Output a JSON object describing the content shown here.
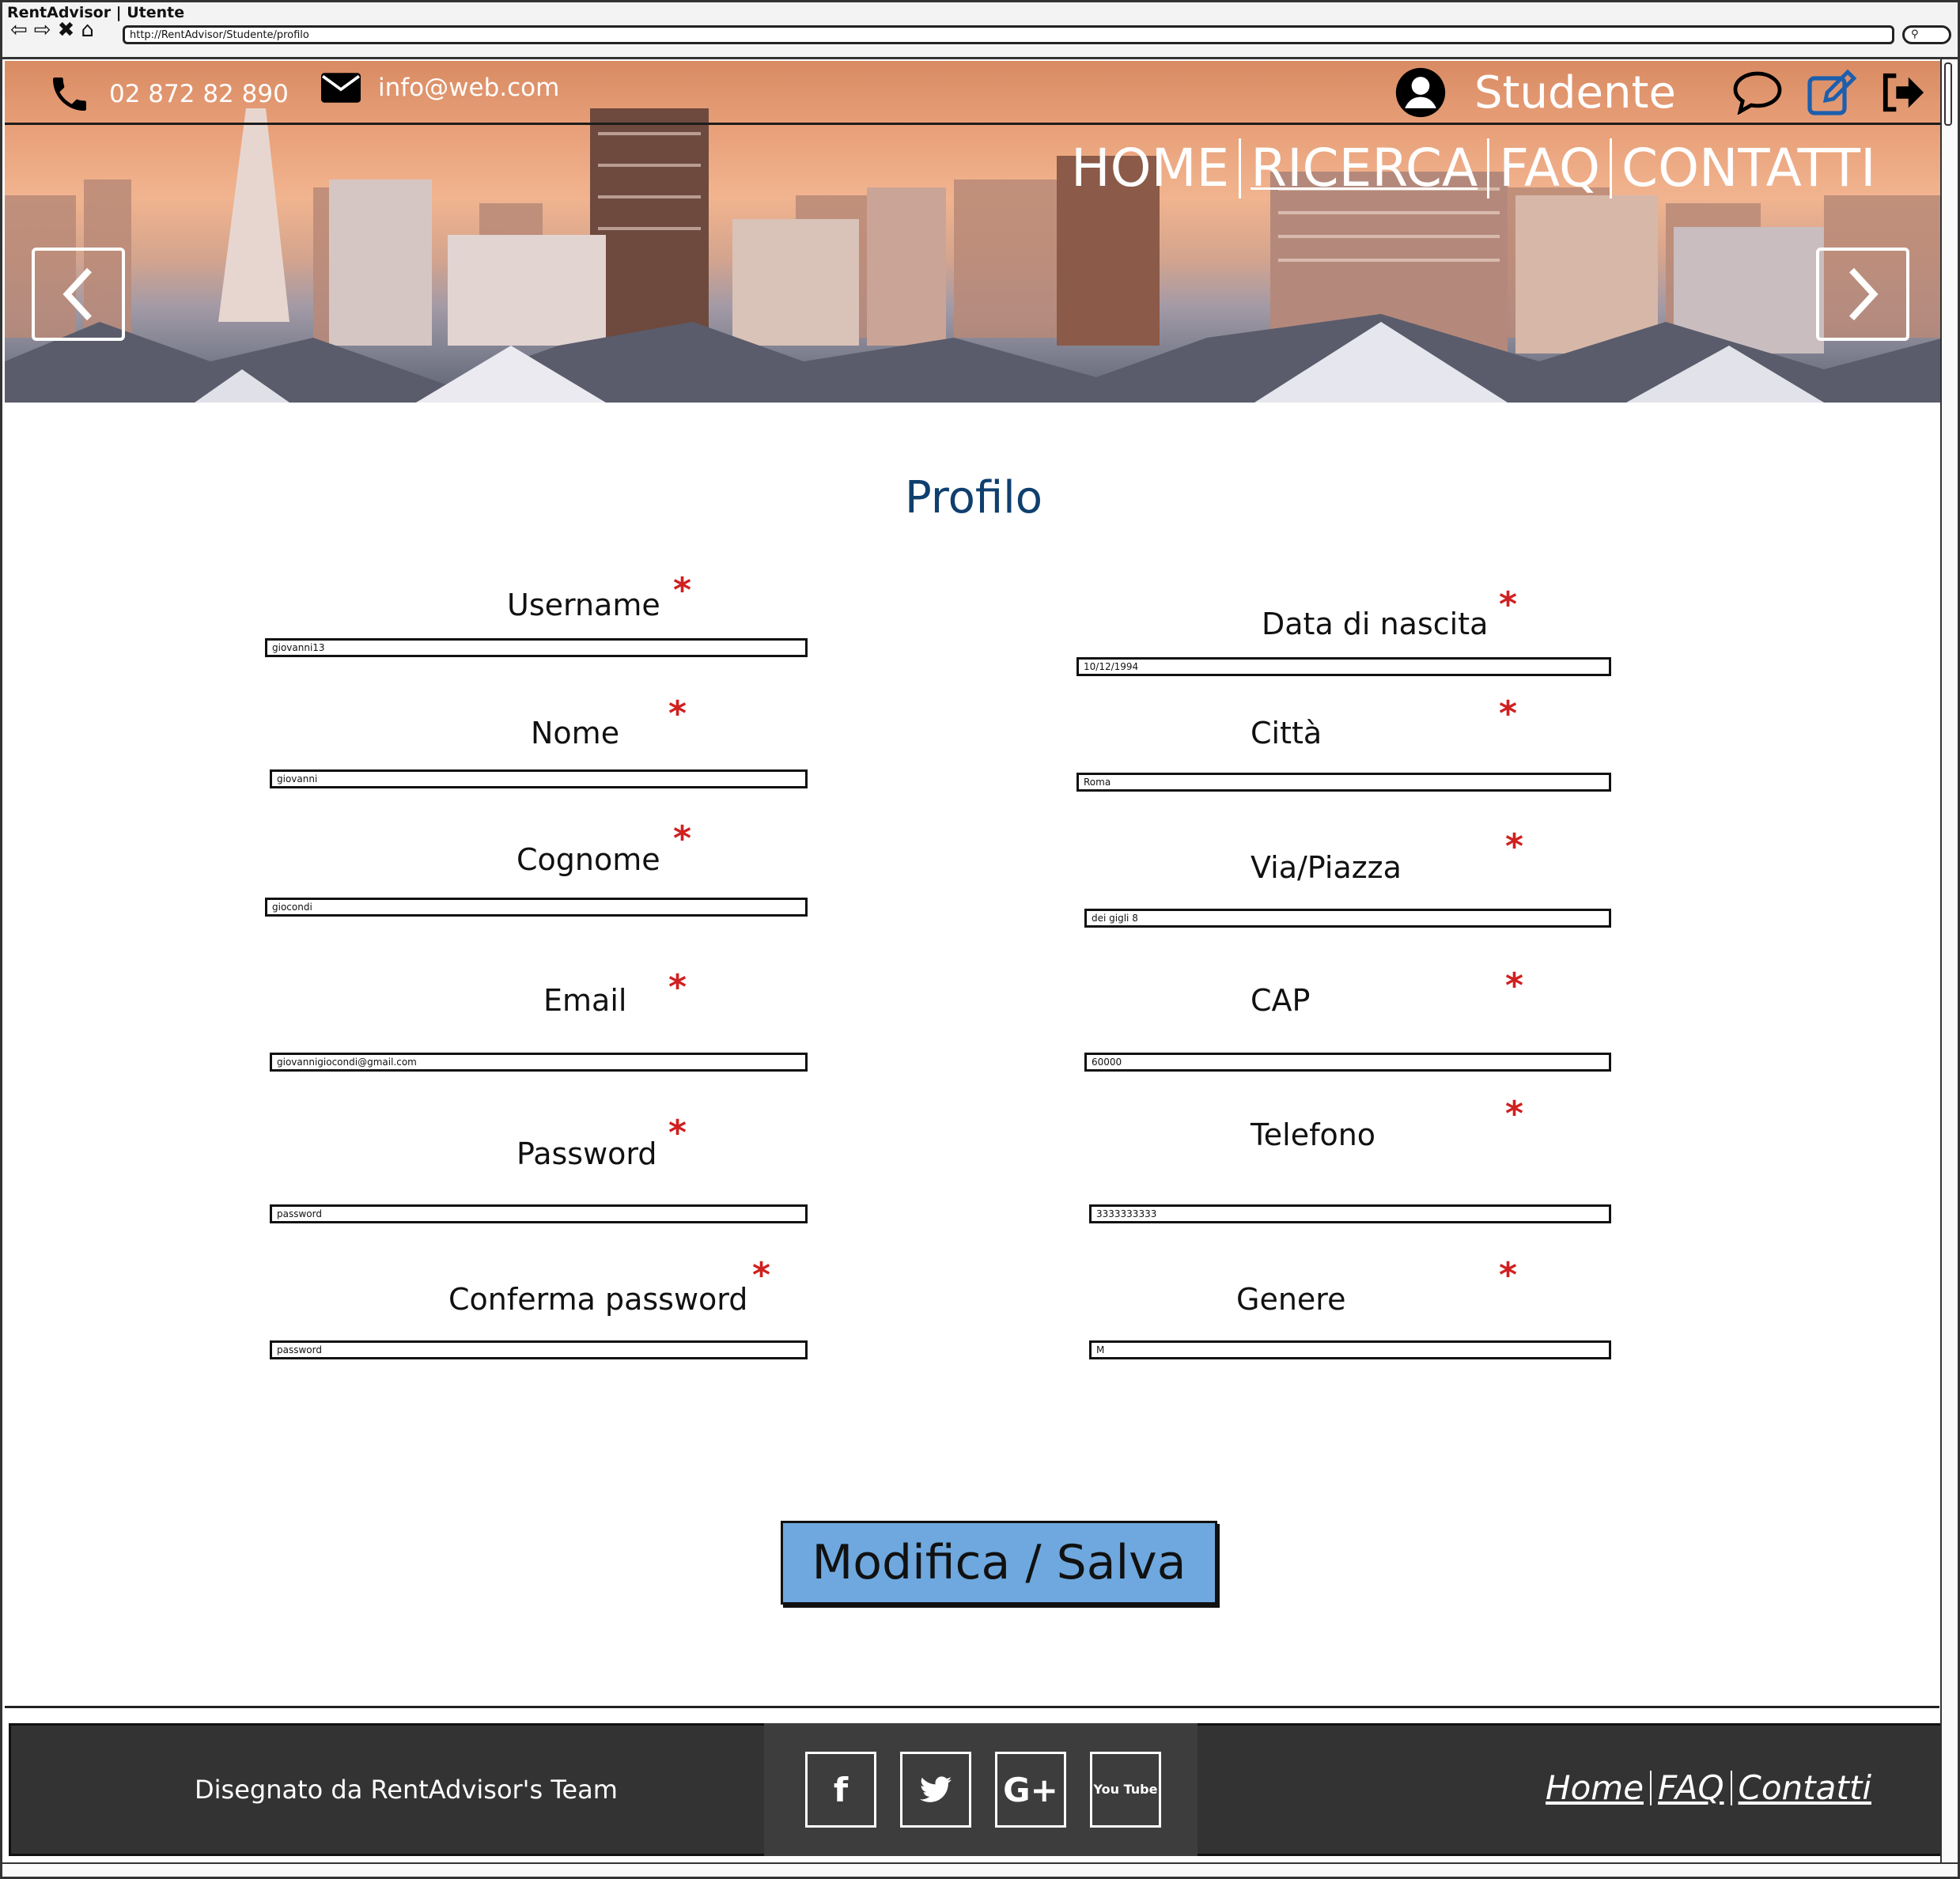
{
  "window": {
    "title": "RentAdvisor | Utente",
    "url": "http://RentAdvisor/Studente/profilo"
  },
  "header": {
    "phone": "02 872 82 890",
    "email": "info@web.com",
    "user_label": "Studente",
    "icons": [
      "user-icon",
      "chat-icon",
      "edit-icon",
      "logout-icon"
    ],
    "nav": [
      {
        "label": "HOME"
      },
      {
        "label": "RICERCA"
      },
      {
        "label": "FAQ"
      },
      {
        "label": "CONTATTI"
      }
    ]
  },
  "main": {
    "title": "Profilo",
    "left_fields": [
      {
        "label": "Username",
        "value": "giovanni13"
      },
      {
        "label": "Nome",
        "value": "giovanni"
      },
      {
        "label": "Cognome",
        "value": "giocondi"
      },
      {
        "label": "Email",
        "value": "giovannigiocondi@gmail.com"
      },
      {
        "label": "Password",
        "value": "password"
      },
      {
        "label": "Conferma password",
        "value": "password"
      }
    ],
    "right_fields": [
      {
        "label": "Data di nascita",
        "value": "10/12/1994"
      },
      {
        "label": "Città",
        "value": "Roma"
      },
      {
        "label": "Via/Piazza",
        "value": "dei gigli 8"
      },
      {
        "label": "CAP",
        "value": "60000"
      },
      {
        "label": "Telefono",
        "value": "3333333333"
      },
      {
        "label": "Genere",
        "value": "M"
      }
    ],
    "required_mark": "*",
    "save_label": "Modifica / Salva"
  },
  "footer": {
    "credit": "Disegnato da RentAdvisor's Team",
    "social": [
      "f",
      "t",
      "G+",
      "You Tube"
    ],
    "links": [
      "Home",
      "FAQ",
      "Contatti"
    ]
  },
  "colors": {
    "title": "#0f3f6e",
    "required": "#d02020",
    "button": "#6ea8de",
    "footer": "#333333"
  }
}
